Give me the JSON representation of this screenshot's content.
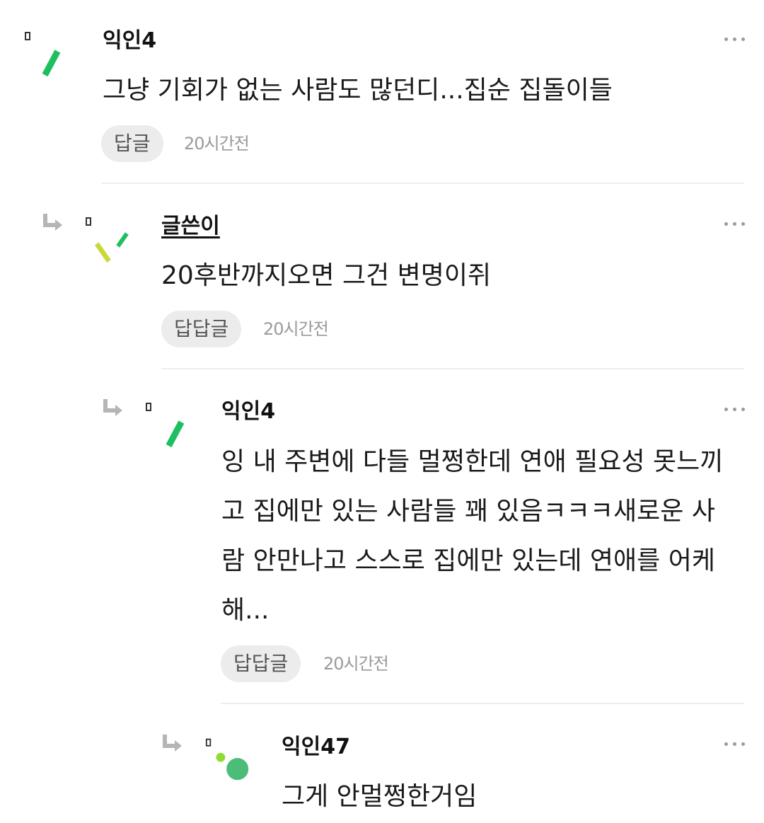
{
  "comments": [
    {
      "author": "익인4",
      "lines": [
        "그냥 기회가 없는 사람도 많던디...집순 집돌이들"
      ],
      "reply_label": "답글",
      "time": "20시간전"
    },
    {
      "author": "글쓴이",
      "lines": [
        "20후반까지오면 그건 변명이쥐"
      ],
      "reply_label": "답답글",
      "time": "20시간전"
    },
    {
      "author": "익인4",
      "lines": [
        "잉 내 주변에 다들 멀쩡한데 연애 필요성 못느끼",
        "고 집에만 있는 사람들 꽤 있음ㅋㅋㅋ새로운 사",
        "람 안만나고 스스로 집에만 있는데 연애를 어케",
        "해..."
      ],
      "reply_label": "답답글",
      "time": "20시간전"
    },
    {
      "author": "익인47",
      "lines": [
        "그게 안멀쩡한거임"
      ]
    }
  ],
  "colors": {
    "avatar_green": "#1fbf5f",
    "avatar_yellow": "#c9d93a",
    "avatar_lime": "#8ddc2f",
    "avatar_teal": "#4cbd78"
  },
  "icons": {
    "reply_arrow": "reply-arrow-icon",
    "more": "more-icon"
  }
}
